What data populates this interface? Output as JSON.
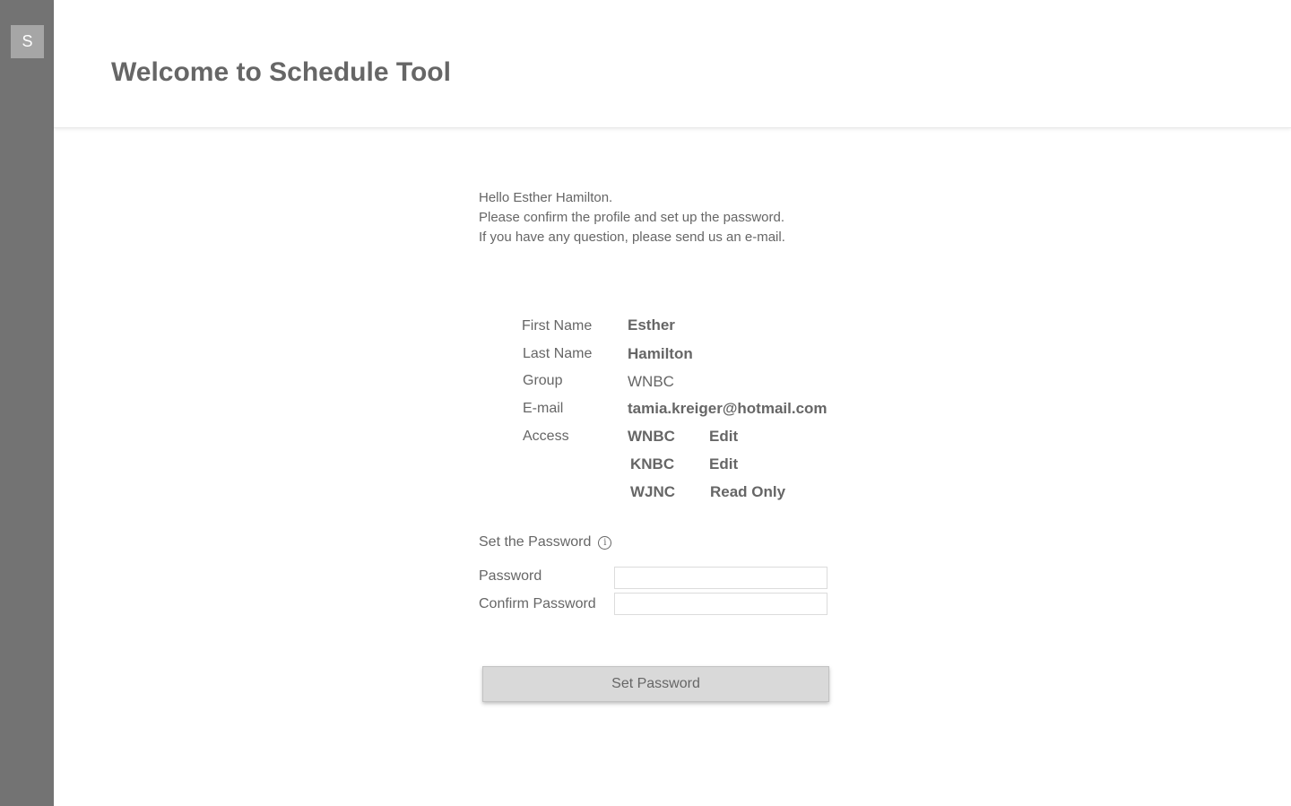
{
  "sidebar": {
    "logo_letter": "S"
  },
  "header": {
    "title": "Welcome to Schedule Tool"
  },
  "intro": {
    "line1": "Hello Esther Hamilton.",
    "line2": "Please confirm the profile and set up the password.",
    "line3": "If you have any question, please send us an e-mail."
  },
  "profile": {
    "first_name_label": "First Name",
    "first_name": "Esther",
    "last_name_label": "Last Name",
    "last_name": "Hamilton",
    "group_label": "Group",
    "group": "WNBC",
    "email_label": "E-mail",
    "email": "tamia.kreiger@hotmail.com",
    "access_label": "Access",
    "access": [
      {
        "station": "WNBC",
        "level": "Edit"
      },
      {
        "station": "KNBC",
        "level": "Edit"
      },
      {
        "station": "WJNC",
        "level": "Read Only"
      }
    ]
  },
  "password_section": {
    "title": "Set the Password",
    "info_icon": "i",
    "password_label": "Password",
    "password_value": "",
    "confirm_label": "Confirm Password",
    "confirm_value": "",
    "submit_label": "Set Password"
  }
}
